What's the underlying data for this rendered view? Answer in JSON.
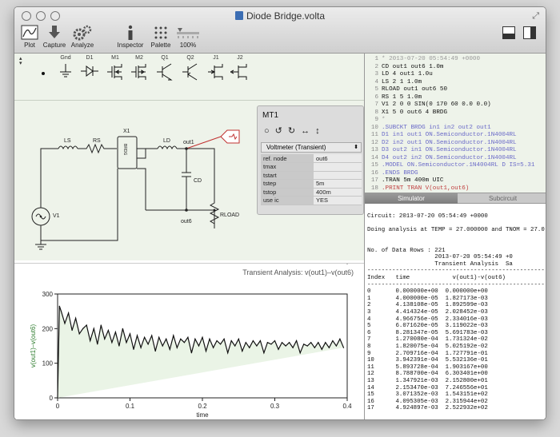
{
  "window": {
    "title": "Diode Bridge.volta"
  },
  "toolbar": {
    "plot": "Plot",
    "capture": "Capture",
    "analyze": "Analyze",
    "inspector": "Inspector",
    "palette": "Palette",
    "zoom": "100%"
  },
  "palette": {
    "items": [
      "Gnd",
      "D1",
      "M1",
      "M2",
      "Q1",
      "Q2",
      "J1",
      "J2"
    ]
  },
  "schematic": {
    "labels": {
      "ls": "LS",
      "rs": "RS",
      "x1": "X1",
      "bridge": "BRDG",
      "ld": "LD",
      "out1": "out1",
      "cd": "CD",
      "rload": "RLOAD",
      "out6": "out6",
      "v1": "V1"
    }
  },
  "inspector": {
    "title": "MT1",
    "selected": "Voltmeter (Transient)",
    "rows": [
      {
        "k": "ref. node",
        "v": "out6"
      },
      {
        "k": "tmax",
        "v": ""
      },
      {
        "k": "tstart",
        "v": ""
      },
      {
        "k": "tstep",
        "v": "5m"
      },
      {
        "k": "tstop",
        "v": "400m"
      },
      {
        "k": "use ic",
        "v": "YES"
      }
    ]
  },
  "plot": {
    "title": "Transient Analysis: v(out1)–v(out6)",
    "chart_data": {
      "type": "line",
      "xlabel": "time",
      "ylabel": "v(out1)–v(out6)",
      "xlim": [
        0,
        0.4
      ],
      "ylim": [
        0,
        300
      ],
      "xticks": [
        "0",
        "0.1",
        "0.2",
        "0.3",
        "0.4"
      ],
      "yticks": [
        "0",
        "100",
        "200",
        "300"
      ],
      "x": [
        0,
        0.0025,
        0.005,
        0.01,
        0.015,
        0.02,
        0.025,
        0.03,
        0.035,
        0.04,
        0.045,
        0.05,
        0.055,
        0.06,
        0.065,
        0.07,
        0.075,
        0.08,
        0.085,
        0.09,
        0.095,
        0.1,
        0.105,
        0.11,
        0.115,
        0.12,
        0.125,
        0.13,
        0.135,
        0.14,
        0.145,
        0.15,
        0.155,
        0.16,
        0.165,
        0.17,
        0.175,
        0.18,
        0.185,
        0.19,
        0.195,
        0.2,
        0.205,
        0.21,
        0.215,
        0.22,
        0.225,
        0.23,
        0.235,
        0.24,
        0.245,
        0.25,
        0.255,
        0.26,
        0.265,
        0.27,
        0.275,
        0.28,
        0.285,
        0.29,
        0.295,
        0.3,
        0.305,
        0.31,
        0.315,
        0.32,
        0.325,
        0.33,
        0.335,
        0.34,
        0.345,
        0.35,
        0.355,
        0.36,
        0.365,
        0.37,
        0.375,
        0.38,
        0.385,
        0.39,
        0.395,
        0.4
      ],
      "y": [
        0,
        265,
        250,
        215,
        245,
        195,
        230,
        185,
        200,
        210,
        165,
        200,
        155,
        210,
        170,
        195,
        160,
        190,
        150,
        200,
        160,
        185,
        140,
        180,
        145,
        175,
        155,
        180,
        135,
        175,
        150,
        170,
        140,
        180,
        145,
        170,
        160,
        175,
        130,
        170,
        150,
        175,
        135,
        170,
        145,
        165,
        155,
        170,
        130,
        165,
        150,
        170,
        135,
        160,
        145,
        165,
        150,
        165,
        130,
        160,
        155,
        165,
        140,
        160,
        150,
        160,
        145,
        165,
        130,
        155,
        150,
        160,
        145,
        160,
        140,
        160,
        145,
        165,
        150,
        170,
        145
      ]
    }
  },
  "netlist": {
    "lines": [
      {
        "n": "1",
        "t": "* 2013-07-20 05:54:49 +0000",
        "c": "#999999"
      },
      {
        "n": "2",
        "t": "CD out1 out6 1.0m",
        "c": "#111111"
      },
      {
        "n": "3",
        "t": "LD 4 out1 1.0u",
        "c": "#111111"
      },
      {
        "n": "4",
        "t": "LS 2 1 1.0m",
        "c": "#111111"
      },
      {
        "n": "5",
        "t": "RLOAD out1 out6 50",
        "c": "#111111"
      },
      {
        "n": "6",
        "t": "RS 1 5 1.0m",
        "c": "#111111"
      },
      {
        "n": "7",
        "t": "V1 2 0 0 SIN(0 170 60 0.0 0.0)",
        "c": "#111111"
      },
      {
        "n": "8",
        "t": "X1 5 0 out6 4 BRDG",
        "c": "#111111"
      },
      {
        "n": "9",
        "t": "*",
        "c": "#999999"
      },
      {
        "n": "10",
        "t": ".SUBCKT BRDG in1 in2 out2 out1",
        "c": "#6a6ac8"
      },
      {
        "n": "11",
        "t": "D1 in1 out1 ON.Semiconductor.1N4004RL",
        "c": "#6a6ac8"
      },
      {
        "n": "12",
        "t": "D2 in2 out1 ON.Semiconductor.1N4004RL",
        "c": "#6a6ac8"
      },
      {
        "n": "13",
        "t": "D3 out2 in1 ON.Semiconductor.1N4004RL",
        "c": "#6a6ac8"
      },
      {
        "n": "14",
        "t": "D4 out2 in2 ON.Semiconductor.1N4004RL",
        "c": "#6a6ac8"
      },
      {
        "n": "15",
        "t": ".MODEL ON.Semiconductor.1N4004RL D IS=5.31",
        "c": "#6a6ac8"
      },
      {
        "n": "16",
        "t": ".ENDS BRDG",
        "c": "#6a6ac8"
      },
      {
        "n": "17",
        "t": ".TRAN 5m 400m UIC",
        "c": "#111111"
      },
      {
        "n": "18",
        "t": ".PRINT TRAN V(out1,out6)",
        "c": "#c04040"
      }
    ]
  },
  "tabs": {
    "simulator": "Simulator",
    "subcircuit": "Subcircuit"
  },
  "output": {
    "lines": [
      "",
      "Circuit: 2013-07-20 05:54:49 +0000",
      "",
      "Doing analysis at TEMP = 27.000000 and TNOM = 27.0",
      "",
      "",
      "No. of Data Rows : 221",
      "                   2013-07-20 05:54:49 +0",
      "                   Transient Analysis  Sa",
      "--------------------------------------------------",
      "Index   time            v(out1)-v(out6)",
      "--------------------------------------------------",
      "0       0.000000e+00  0.000000e+00",
      "1       4.000000e-05  1.827173e-03",
      "2       4.138108e-05  1.892599e-03",
      "3       4.414324e-05  2.028452e-03",
      "4       4.966756e-05  2.334016e-03",
      "5       6.071620e-05  3.119022e-03",
      "6       8.281347e-05  5.691783e-03",
      "7       1.270080e-04  1.731324e-02",
      "8       1.820075e-04  5.025192e-02",
      "9       2.709716e-04  1.727791e-01",
      "10      3.942391e-04  5.532136e-01",
      "11      5.893728e-04  1.903167e+00",
      "12      8.788700e-04  6.303401e+00",
      "13      1.347921e-03  2.152800e+01",
      "14      2.153470e-03  7.246556e+01",
      "15      3.071352e-03  1.543151e+02",
      "16      4.095305e-03  2.315944e+02",
      "17      4.924897e-03  2.522932e+02"
    ]
  }
}
